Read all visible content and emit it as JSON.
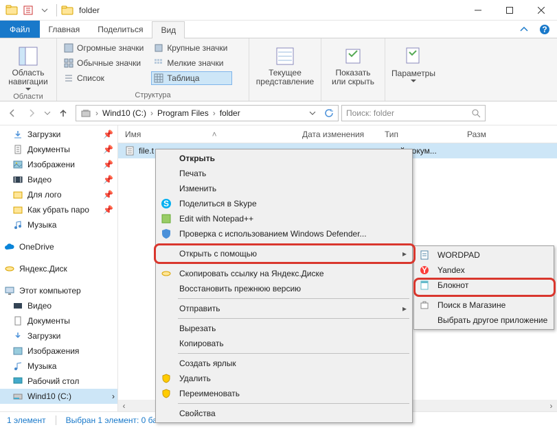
{
  "window": {
    "title": "folder"
  },
  "ribbon_tabs": {
    "file": "Файл",
    "home": "Главная",
    "share": "Поделиться",
    "view": "Вид"
  },
  "ribbon": {
    "nav_pane": "Область\nнавигации",
    "group_panes": "Области",
    "layouts": {
      "huge": "Огромные значки",
      "large": "Крупные значки",
      "normal": "Обычные значки",
      "small": "Мелкие значки",
      "list": "Список",
      "table": "Таблица"
    },
    "group_layout": "Структура",
    "current_view": "Текущее\nпредставление",
    "show_hide": "Показать\nили скрыть",
    "options": "Параметры"
  },
  "breadcrumbs": [
    "Wind10 (C:)",
    "Program Files",
    "folder"
  ],
  "search": {
    "placeholder": "Поиск: folder"
  },
  "columns": {
    "name": "Имя",
    "date": "Дата изменения",
    "type": "Тип",
    "size": "Разм"
  },
  "file": {
    "name": "file.t",
    "type_trunc": "ый докум..."
  },
  "sidebar": {
    "quick": [
      "Загрузки",
      "Документы",
      "Изображени",
      "Видео",
      "Для лого",
      "Как убрать паро",
      "Музыка"
    ],
    "onedrive": "OneDrive",
    "yadisk": "Яндекс.Диск",
    "thispc": "Этот компьютер",
    "thispc_items": [
      "Видео",
      "Документы",
      "Загрузки",
      "Изображения",
      "Музыка",
      "Рабочий стол"
    ],
    "drive": "Wind10 (C:)"
  },
  "ctx1": {
    "open": "Открыть",
    "print": "Печать",
    "edit": "Изменить",
    "skype": "Поделиться в Skype",
    "npp": "Edit with Notepad++",
    "defender": "Проверка с использованием Windows Defender...",
    "openwith": "Открыть с помощью",
    "yalink": "Скопировать ссылку на Яндекс.Диске",
    "restore": "Восстановить прежнюю версию",
    "sendto": "Отправить",
    "cut": "Вырезать",
    "copy": "Копировать",
    "shortcut": "Создать ярлык",
    "delete": "Удалить",
    "rename": "Переименовать",
    "props": "Свойства"
  },
  "ctx2": {
    "wordpad": "WORDPAD",
    "yandex": "Yandex",
    "notepad": "Блокнот",
    "store": "Поиск в Магазине",
    "choose": "Выбрать другое приложение"
  },
  "status": {
    "count": "1 элемент",
    "selected": "Выбран 1 элемент: 0 ба"
  }
}
